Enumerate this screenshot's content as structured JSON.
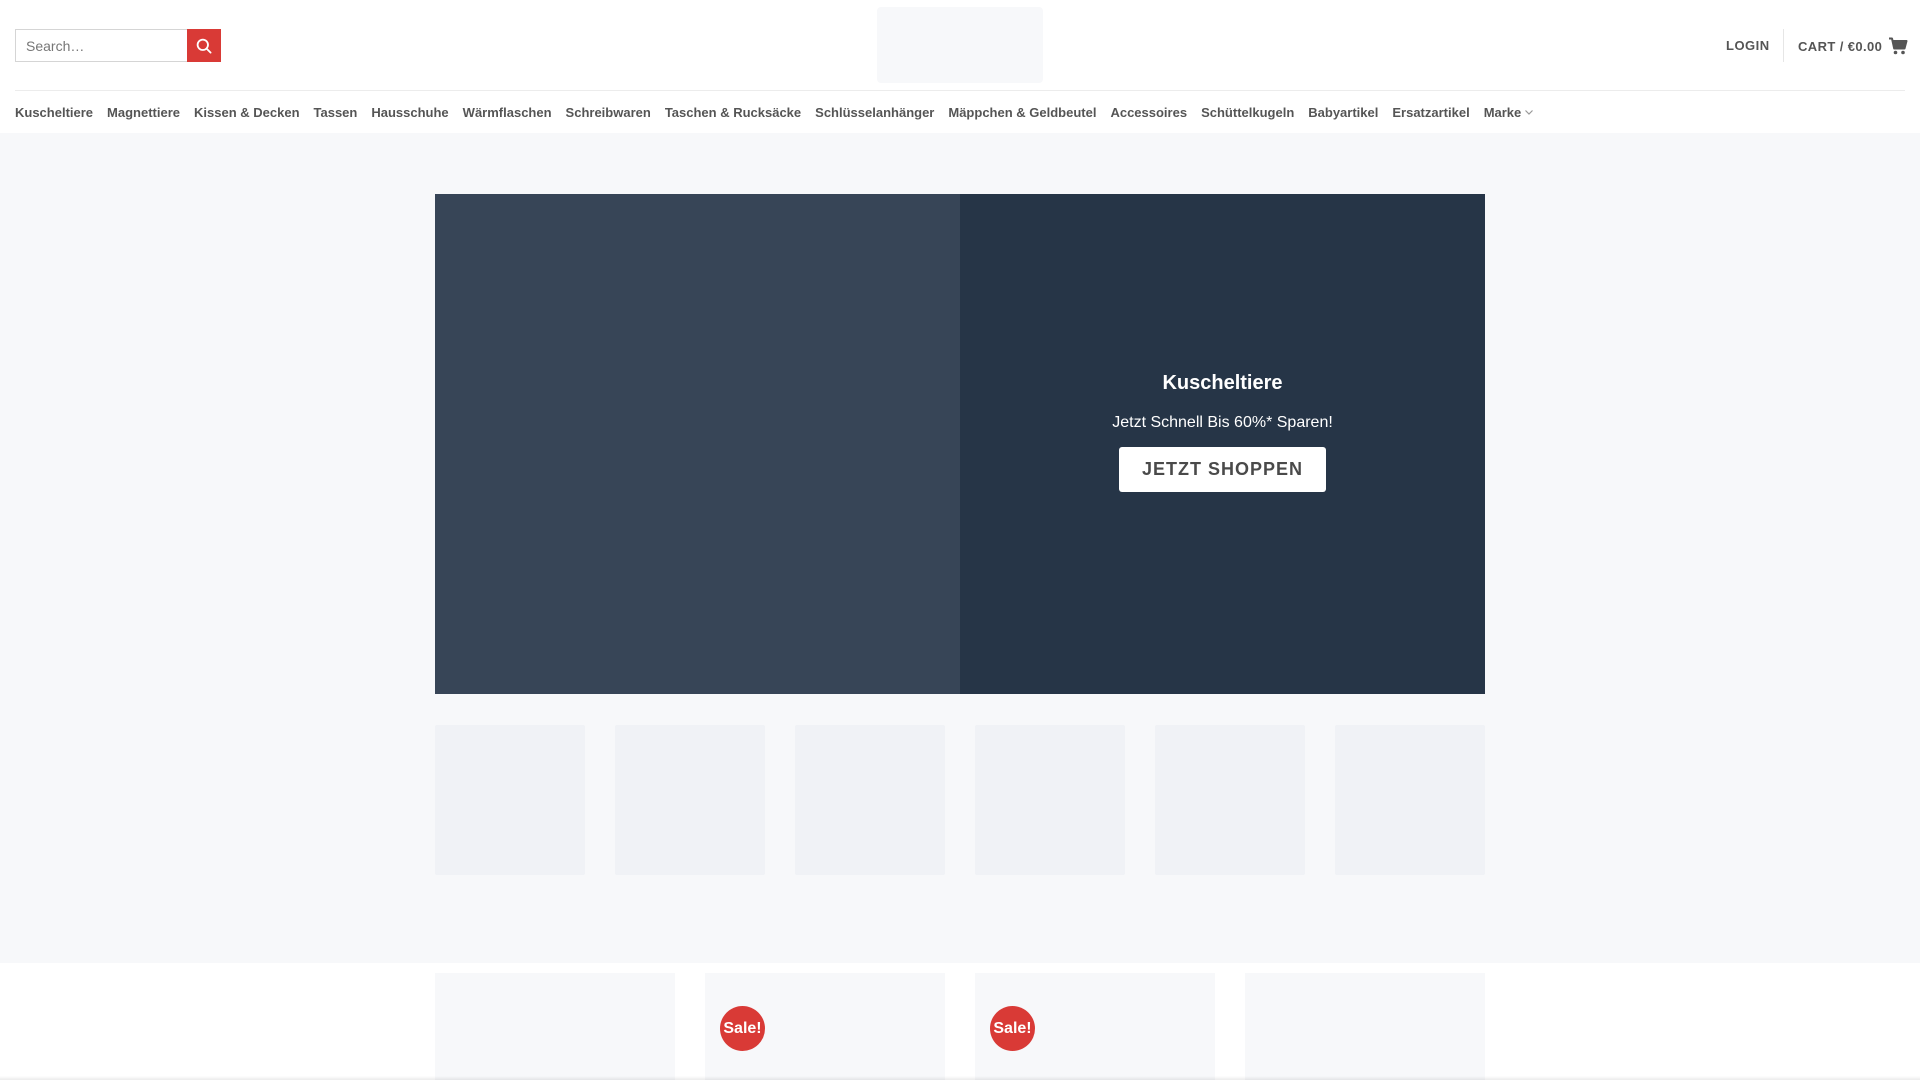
{
  "header": {
    "search": {
      "placeholder": "Search…"
    },
    "login_label": "LOGIN",
    "cart": {
      "label": "CART",
      "separator": "/",
      "total": "€0.00"
    }
  },
  "nav": {
    "items": [
      {
        "label": "Kuscheltiere"
      },
      {
        "label": "Magnettiere"
      },
      {
        "label": "Kissen & Decken"
      },
      {
        "label": "Tassen"
      },
      {
        "label": "Hausschuhe"
      },
      {
        "label": "Wärmflaschen"
      },
      {
        "label": "Schreibwaren"
      },
      {
        "label": "Taschen & Rucksäcke"
      },
      {
        "label": "Schlüsselanhänger"
      },
      {
        "label": "Mäppchen & Geldbeutel"
      },
      {
        "label": "Accessoires"
      },
      {
        "label": "Schüttelkugeln"
      },
      {
        "label": "Babyartikel"
      },
      {
        "label": "Ersatzartikel"
      },
      {
        "label": "Marke"
      }
    ]
  },
  "hero": {
    "title": "Kuscheltiere",
    "subtitle": "Jetzt Schnell Bis 60%* Sparen!",
    "cta_label": "JETZT SHOPPEN"
  },
  "products": [
    {
      "sale": false,
      "badge": ""
    },
    {
      "sale": true,
      "badge": "Sale!"
    },
    {
      "sale": true,
      "badge": "Sale!"
    },
    {
      "sale": false,
      "badge": ""
    }
  ],
  "colors": {
    "accent": "#d93a36",
    "hero_left": "#374557",
    "hero_right": "#263547",
    "page_bg": "#f7f8fa"
  }
}
